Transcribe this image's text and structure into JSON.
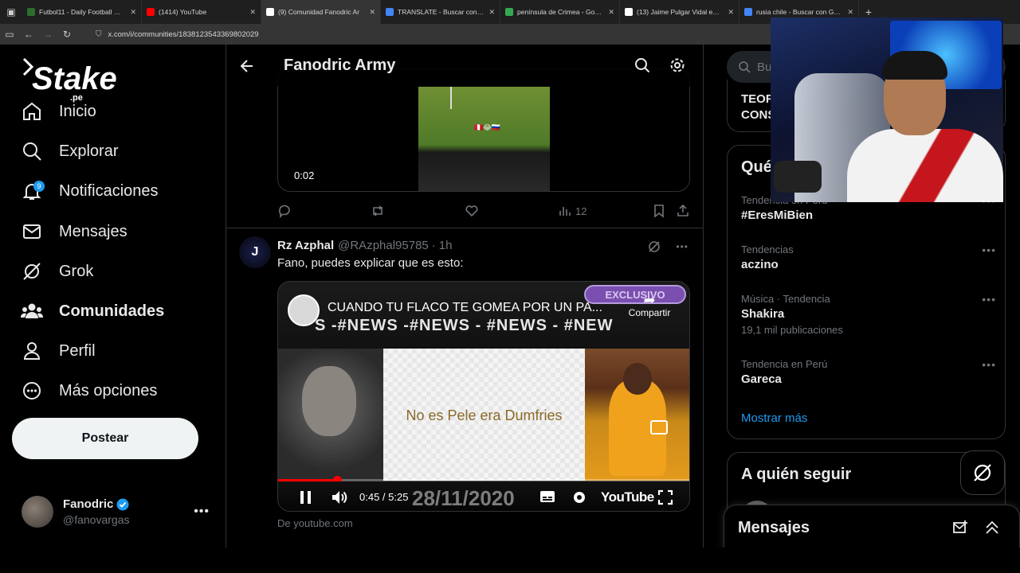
{
  "browser": {
    "tabs": [
      {
        "title": "Futbol11 - Daily Football Games",
        "fav_color": "#2b6e2b",
        "active": false
      },
      {
        "title": "(1414) YouTube",
        "fav_color": "#ff0000",
        "active": false
      },
      {
        "title": "(9) Comunidad Fanodric Ar",
        "fav_color": "#ffffff",
        "active": true
      },
      {
        "title": "TRANSLATE - Buscar con Googl",
        "fav_color": "#4285f4",
        "active": false
      },
      {
        "title": "península de Crimea - Google M",
        "fav_color": "#34a853",
        "active": false
      },
      {
        "title": "(13) Jaime Pulgar Vidal en X: \"H",
        "fav_color": "#ffffff",
        "active": false
      },
      {
        "title": "rusia chile - Buscar con Google",
        "fav_color": "#4285f4",
        "active": false
      }
    ],
    "url": "x.com/i/communities/1838123543369802029"
  },
  "brand": {
    "logo_text": "Stake",
    "logo_sub": ".pe"
  },
  "nav": {
    "items": [
      {
        "label": "Inicio",
        "icon": "home-icon",
        "bold": false
      },
      {
        "label": "Explorar",
        "icon": "search-icon",
        "bold": false
      },
      {
        "label": "Notificaciones",
        "icon": "bell-icon",
        "bold": false,
        "badge": "9"
      },
      {
        "label": "Mensajes",
        "icon": "mail-icon",
        "bold": false
      },
      {
        "label": "Grok",
        "icon": "grok-icon",
        "bold": false
      },
      {
        "label": "Comunidades",
        "icon": "communities-icon",
        "bold": true
      },
      {
        "label": "Perfil",
        "icon": "person-icon",
        "bold": false
      },
      {
        "label": "Más opciones",
        "icon": "more-circle-icon",
        "bold": false
      }
    ],
    "post_button": "Postear",
    "user": {
      "name": "Fanodric",
      "handle": "@fanovargas"
    }
  },
  "main": {
    "title": "Fanodric Army",
    "tweet1": {
      "video_time": "0:02",
      "views": "12"
    },
    "tweet2": {
      "avatar_letter": "J",
      "name": "Rz Azphal",
      "handle": "@RAzphal95785",
      "sep": "·",
      "time": "1h",
      "text": "Fano, puedes explicar que es esto:",
      "youtube": {
        "title": "CUANDO TU FLACO TE GOMEA POR UN PA...",
        "exclusive": "EXCLUSIVO",
        "share": "Compartir",
        "ticker": "S -#NEWS -#NEWS - #NEWS - #NEW",
        "center_text": "No es Pele era Dumfries",
        "time": "0:45 / 5:25",
        "progress": 0.143,
        "date_overlay": "28/11/2020",
        "yt_logo": "YouTube"
      },
      "source": "De youtube.com"
    }
  },
  "right": {
    "search_placeholder": "Bus",
    "card_text_line1": "TEOR",
    "card_text_line2": "CONS",
    "trends_header": "Qué",
    "trends": [
      {
        "context": "Tendencia en Perú",
        "name": "#EresMiBien",
        "count": ""
      },
      {
        "context": "Tendencias",
        "name": "aczino",
        "count": ""
      },
      {
        "context": "Música · Tendencia",
        "name": "Shakira",
        "count": "19,1 mil publicaciones"
      },
      {
        "context": "Tendencia en Perú",
        "name": "Gareca",
        "count": ""
      }
    ],
    "show_more": "Mostrar más",
    "who_to_follow": "A quién seguir",
    "messages": "Mensajes"
  },
  "colors": {
    "accent": "#1d9bf0",
    "background": "#000000",
    "border": "#2f3336",
    "muted": "#71767b"
  }
}
